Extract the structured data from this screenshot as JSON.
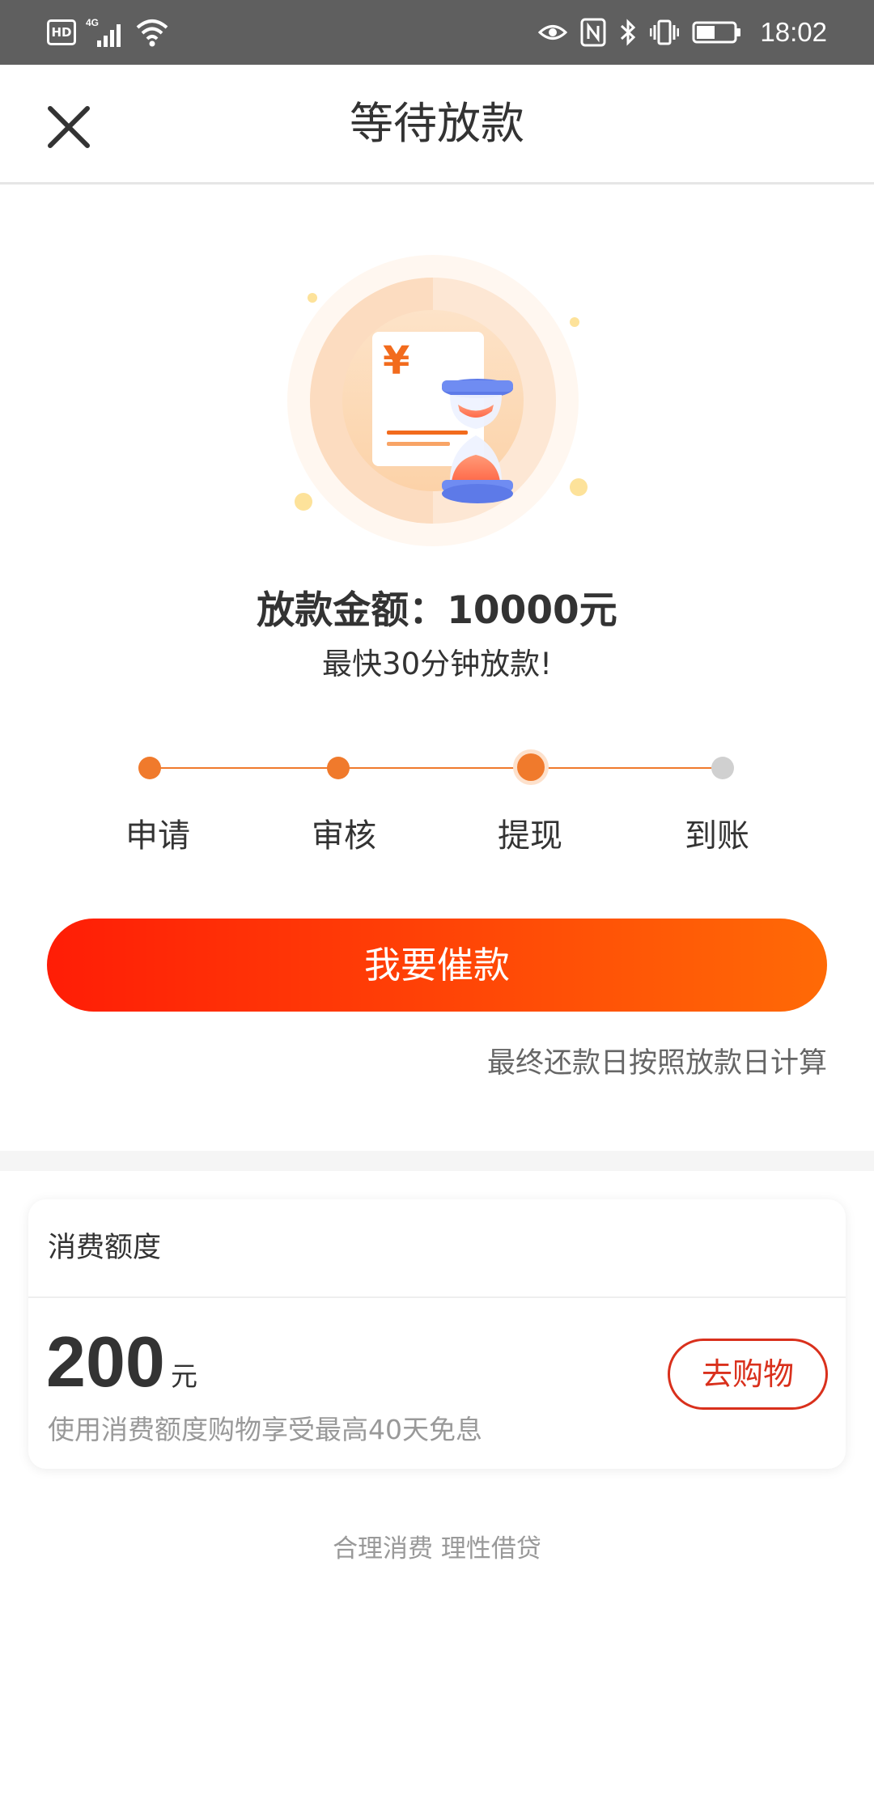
{
  "status_bar": {
    "hd": "HD",
    "network": "4G",
    "time": "18:02"
  },
  "header": {
    "title": "等待放款"
  },
  "illustration": {
    "yen_symbol": "¥"
  },
  "loan": {
    "amount_text": "放款金额：10000元",
    "subtitle": "最快30分钟放款!"
  },
  "steps": [
    {
      "label": "申请",
      "state": "done"
    },
    {
      "label": "审核",
      "state": "done"
    },
    {
      "label": "提现",
      "state": "current"
    },
    {
      "label": "到账",
      "state": "pending"
    }
  ],
  "actions": {
    "urge_label": "我要催款",
    "repay_note": "最终还款日按照放款日计算"
  },
  "credit": {
    "title": "消费额度",
    "amount": "200",
    "unit": "元",
    "description": "使用消费额度购物享受最高40天免息",
    "shop_label": "去购物"
  },
  "footer": {
    "slogan": "合理消费 理性借贷"
  },
  "colors": {
    "accent": "#f07a2c",
    "button_start": "#ff1d06",
    "button_end": "#ff6a06",
    "shop_red": "#d9301c",
    "pending_gray": "#d0d0d0"
  }
}
